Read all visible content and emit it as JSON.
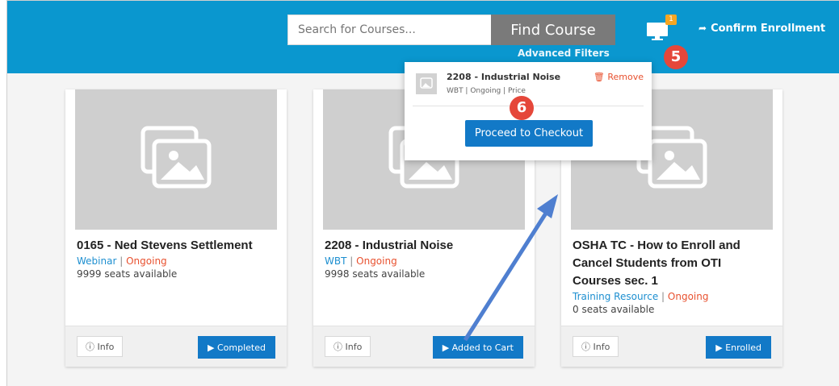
{
  "header": {
    "search_placeholder": "Search for Courses...",
    "find_button": "Find Course",
    "advanced_filters": "Advanced Filters",
    "cart_count": "1",
    "confirm_enrollment": "Confirm Enrollment"
  },
  "steps": {
    "five": "5",
    "six": "6"
  },
  "cart_dropdown": {
    "item_title": "2208 - Industrial Noise",
    "item_meta": "WBT | Ongoing | Price",
    "remove_label": "Remove",
    "checkout_label": "Proceed to Checkout"
  },
  "cards": [
    {
      "title": "0165 - Ned Stevens Settlement",
      "type": "Webinar",
      "sep": "|",
      "status": "Ongoing",
      "seats": "9999 seats available",
      "info": "Info",
      "action": "Completed"
    },
    {
      "title": "2208 - Industrial Noise",
      "type": "WBT",
      "sep": "|",
      "status": "Ongoing",
      "seats": "9998 seats available",
      "info": "Info",
      "action": "Added to Cart"
    },
    {
      "title": "OSHA TC - How to Enroll and Cancel Students from OTI Courses sec. 1",
      "type": "Training Resource",
      "sep": "|",
      "status": "Ongoing",
      "seats": "0 seats available",
      "info": "Info",
      "action": "Enrolled"
    }
  ],
  "colors": {
    "header_bg": "#0a97cf",
    "primary_button": "#1279c7",
    "status": "#e8512f",
    "type": "#1d8fd0",
    "step_badge": "#e5473a",
    "arrow": "#4f7fd0"
  },
  "icons": [
    "monitor-icon",
    "sign-in-icon",
    "image-placeholder-icon",
    "trash-icon",
    "info-circle-icon",
    "play-circle-icon"
  ]
}
